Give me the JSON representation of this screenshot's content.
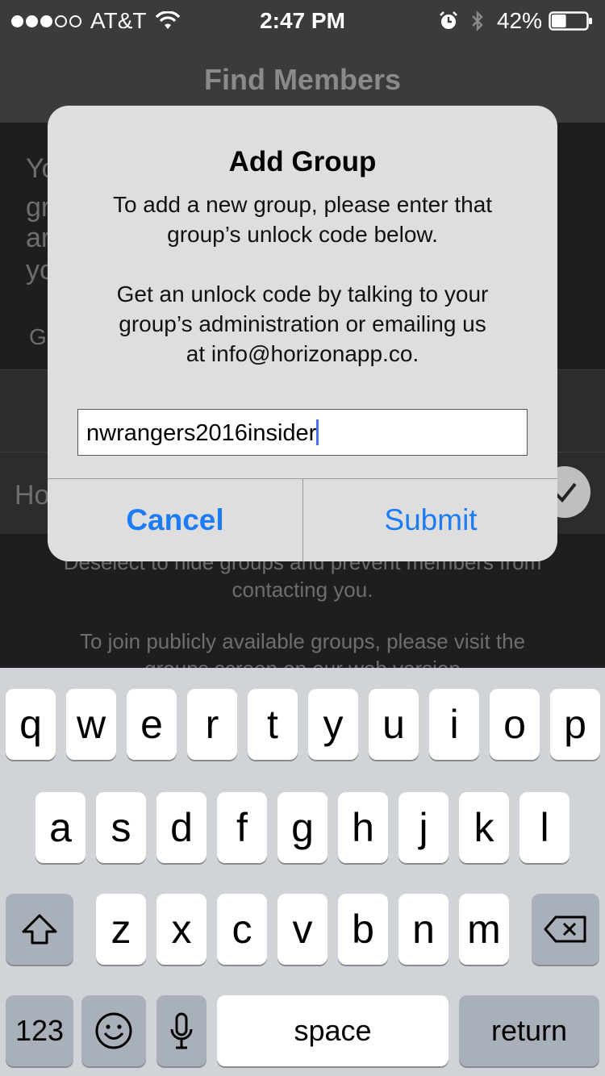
{
  "status_bar": {
    "carrier": "AT&T",
    "time": "2:47 PM",
    "battery": "42%",
    "battery_level": 0.42,
    "icons": [
      "signal-dots-icon",
      "wifi-icon",
      "alarm-icon",
      "bluetooth-icon",
      "battery-icon"
    ]
  },
  "nav": {
    "title": "Find Members"
  },
  "background": {
    "fragments": [
      "Yo",
      "gr",
      "ar",
      "yo",
      "G",
      "Ho"
    ],
    "note_line1": "Deselect to hide groups and prevent members from",
    "note_line2": "contacting you.",
    "note_line3": "To join publicly available groups, please visit the",
    "note_line4": "groups screen on our web version"
  },
  "alert": {
    "title": "Add Group",
    "message_line1": "To add a new group, please enter that",
    "message_line2": "group’s unlock code below.",
    "message_line3": "Get an unlock code by talking to your",
    "message_line4": "group’s administration or emailing us",
    "message_line5": "at info@horizonapp.co.",
    "input_value": "nwrangers2016insider",
    "cancel_label": "Cancel",
    "submit_label": "Submit"
  },
  "keyboard": {
    "row1": [
      "q",
      "w",
      "e",
      "r",
      "t",
      "y",
      "u",
      "i",
      "o",
      "p"
    ],
    "row2": [
      "a",
      "s",
      "d",
      "f",
      "g",
      "h",
      "j",
      "k",
      "l"
    ],
    "row3": [
      "z",
      "x",
      "c",
      "v",
      "b",
      "n",
      "m"
    ],
    "numbers_label": "123",
    "space_label": "space",
    "return_label": "return"
  },
  "colors": {
    "accent": "#1b7cf5",
    "caret": "#4a6ef0",
    "keyboard_bg": "#d0d3d8",
    "alert_bg": "#dedede"
  }
}
